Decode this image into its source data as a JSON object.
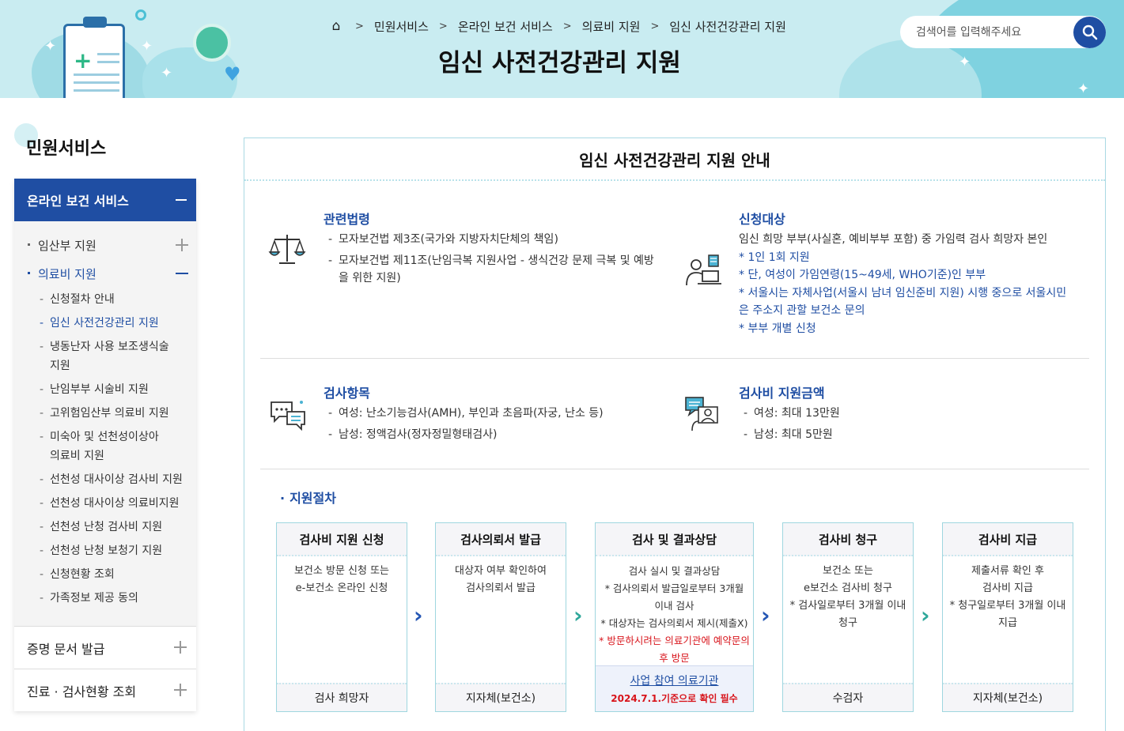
{
  "header": {
    "breadcrumb": [
      "민원서비스",
      "온라인 보건 서비스",
      "의료비 지원",
      "임신 사전건강관리 지원"
    ],
    "page_title": "임신 사전건강관리 지원",
    "search_placeholder": "검색어를 입력해주세요"
  },
  "sidebar": {
    "title": "민원서비스",
    "section": "온라인 보건 서비스",
    "items": [
      {
        "label": "임산부 지원"
      },
      {
        "label": "의료비 지원"
      }
    ],
    "subitems": [
      {
        "label": "신청절차 안내"
      },
      {
        "label": "임신 사전건강관리 지원"
      },
      {
        "label": "냉동난자 사용 보조생식술 지원"
      },
      {
        "label": "난임부부 시술비 지원"
      },
      {
        "label": "고위험임산부 의료비 지원"
      },
      {
        "label": "미숙아 및 선천성이상아 의료비 지원"
      },
      {
        "label": "선천성 대사이상 검사비 지원"
      },
      {
        "label": "선천성 대사이상 의료비지원"
      },
      {
        "label": "선천성 난청 검사비 지원"
      },
      {
        "label": "선천성 난청 보청기 지원"
      },
      {
        "label": "신청현황 조회"
      },
      {
        "label": "가족정보 제공 동의"
      }
    ],
    "bottom": [
      {
        "label": "증명 문서 발급"
      },
      {
        "label": "진료 · 검사현황 조회"
      }
    ]
  },
  "main": {
    "title": "임신 사전건강관리 지원 안내",
    "law": {
      "title": "관련법령",
      "items": [
        "모자보건법 제3조(국가와 지방자치단체의 책임)",
        "모자보건법 제11조(난임극복 지원사업 - 생식건강 문제 극복 및 예방을 위한 지원)"
      ]
    },
    "target": {
      "title": "신청대상",
      "desc": "임신 희망 부부(사실혼, 예비부부 포함) 중 가임력 검사 희망자 본인",
      "notes": [
        "* 1인 1회 지원",
        "* 단, 여성이 가임연령(15~49세, WHO기준)인 부부",
        "* 서울시는 자체사업(서울시 남녀 임신준비 지원) 시행 중으로 서울시민은 주소지 관할 보건소 문의",
        "* 부부 개별 신청"
      ]
    },
    "exam": {
      "title": "검사항목",
      "items": [
        "여성: 난소기능검사(AMH), 부인과 초음파(자궁, 난소 등)",
        "남성: 정액검사(정자정밀형태검사)"
      ]
    },
    "amount": {
      "title": "검사비 지원금액",
      "items": [
        "여성: 최대 13만원",
        "남성: 최대 5만원"
      ]
    },
    "procedure": {
      "title": "지원절차",
      "steps": [
        {
          "head": "검사비 지원 신청",
          "body": [
            "보건소 방문 신청 또는",
            "e-보건소 온라인 신청"
          ],
          "foot": "검사 희망자"
        },
        {
          "head": "검사의뢰서 발급",
          "body": [
            "대상자 여부 확인하여",
            "검사의뢰서 발급"
          ],
          "foot": "지자체(보건소)"
        },
        {
          "head": "검사 및 결과상담",
          "body": [
            "검사 실시 및 결과상담",
            "* 검사의뢰서 발급일로부터 3개월 이내 검사",
            "* 대상자는 검사의뢰서 제시(제출X)"
          ],
          "red": "* 방문하시려는 의료기관에 예약문의 후 방문",
          "link": "사업 참여 의료기관",
          "link_note": "2024.7.1.기준으로 확인 필수"
        },
        {
          "head": "검사비 청구",
          "body": [
            "보건소 또는",
            "e보건소 검사비 청구",
            "* 검사일로부터 3개월 이내 청구"
          ],
          "foot": "수검자"
        },
        {
          "head": "검사비 지급",
          "body": [
            "제출서류 확인 후",
            "검사비 지급",
            "* 청구일로부터 3개월 이내 지급"
          ],
          "foot": "지자체(보건소)"
        }
      ]
    }
  },
  "colors": {
    "primary": "#1f4ea3",
    "accent_green": "#2ea79a",
    "banner": "#c9ecf1",
    "warning": "#d8141b"
  }
}
